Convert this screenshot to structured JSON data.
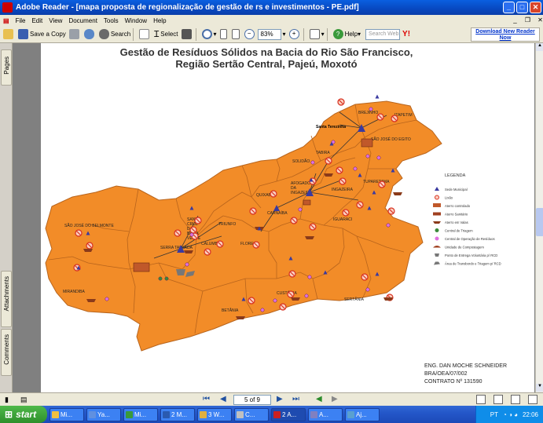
{
  "window": {
    "title": "Adobe Reader - [mapa proposta de regionalização de gestão de rs e investimentos - PE.pdf]"
  },
  "menu": [
    "File",
    "Edit",
    "View",
    "Document",
    "Tools",
    "Window",
    "Help"
  ],
  "toolbar": {
    "save_copy": "Save a Copy",
    "search": "Search",
    "select": "Select",
    "zoom_value": "83%",
    "help": "Help",
    "search_web_placeholder": "Search Web",
    "download_link": "Download New Reader Now"
  },
  "side_tabs": {
    "pages": "Pages",
    "attachments": "Attachments",
    "comments": "Comments"
  },
  "map": {
    "title_line1": "Gestão de Resíduos Sólidos na Bacia do Rio São Francisco,",
    "title_line2": "Região Sertão Central, Pajeú, Moxotó",
    "places": [
      "BREJINHO",
      "ITAPETIM",
      "Santa Terezinha",
      "SÃO JOSÉ DO EGITO",
      "TABIRA",
      "SOLIDÃO",
      "AFOGADOS DA INGAZEIRA",
      "INGAZEIRA",
      "TUPARETAMA",
      "QUIXABA",
      "CARNAÍBA",
      "IGUARACI",
      "SÃO JOSÉ DO BELMONTE",
      "SANTA CRUZ DA BAIXA VERDE",
      "TRIUNFO",
      "SERRA TALHADA",
      "CALUMBI",
      "FLORES",
      "MIRANDIBA",
      "BETÂNIA",
      "CUSTÓDIA",
      "SERTÂNIA"
    ],
    "legend_title": "LEGENDA",
    "legend": [
      "Sede Municipal",
      "Lixão",
      "Aterro controlado",
      "Aterro Sanitário",
      "Aterro em Valas",
      "Central de Triagem",
      "Central de Operação de Resíduos",
      "Unidade de Compostagem",
      "Ponto de Entrega Voluntária p/ RCD",
      "Área de Transbordo e Triagem p/ RCD"
    ],
    "credit": [
      "ENG. DAN MOCHE SCHNEIDER",
      "BRA/OEA/07/002",
      "CONTRATO Nº 131590"
    ]
  },
  "status": {
    "page_indicator": "5 of 9"
  },
  "taskbar": {
    "start": "start",
    "tasks": [
      "Mi...",
      "Ya...",
      "Mi...",
      "2 M...",
      "3 W...",
      "C...",
      "2 A...",
      "A...",
      "Aj..."
    ],
    "lang": "PT",
    "clock": "22:06"
  },
  "colors": {
    "map_fill": "#f28c28",
    "map_stroke": "#b8641c",
    "sede": "#3a3aa0",
    "lixao": "#d83020"
  }
}
